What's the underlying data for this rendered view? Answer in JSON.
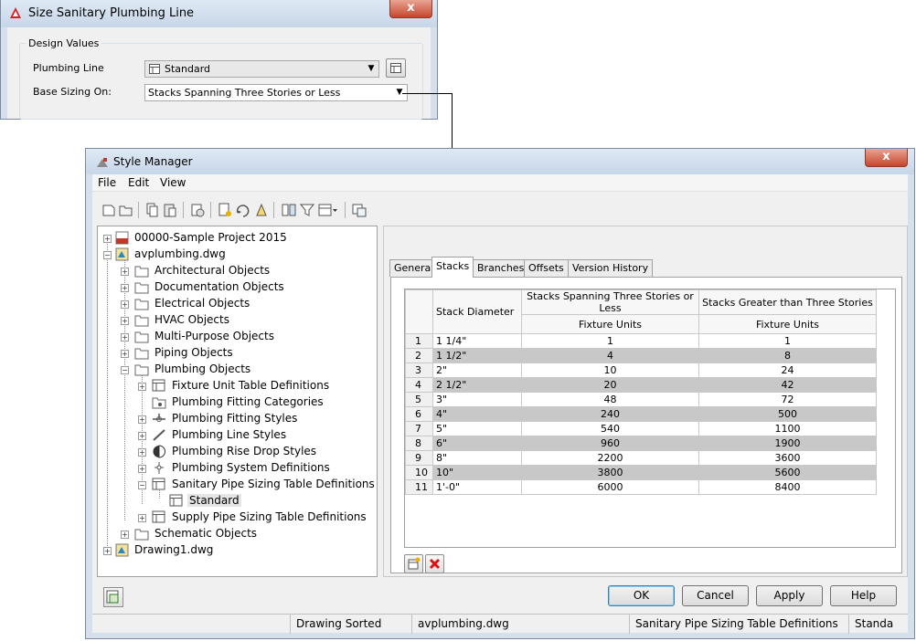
{
  "plumbing_dialog": {
    "title": "Size Sanitary Plumbing Line",
    "close": "x",
    "group_label": "Design Values",
    "plumbing_line_label": "Plumbing Line",
    "plumbing_line_value": "Standard",
    "base_sizing_label": "Base Sizing On:",
    "base_sizing_value": "Stacks Spanning Three Stories or Less"
  },
  "style_manager": {
    "title": "Style Manager",
    "close": "x",
    "menu": [
      "File",
      "Edit",
      "View"
    ],
    "tree": [
      {
        "label": "00000-Sample Project 2015",
        "icon": "project-icon"
      },
      {
        "label": "avplumbing.dwg",
        "icon": "drawing-icon"
      },
      {
        "label": "Architectural Objects",
        "icon": "folder-icon"
      },
      {
        "label": "Documentation Objects",
        "icon": "folder-icon"
      },
      {
        "label": "Electrical Objects",
        "icon": "folder-icon"
      },
      {
        "label": "HVAC Objects",
        "icon": "folder-icon"
      },
      {
        "label": "Multi-Purpose Objects",
        "icon": "folder-icon"
      },
      {
        "label": "Piping Objects",
        "icon": "folder-icon"
      },
      {
        "label": "Plumbing Objects",
        "icon": "folder-open-icon"
      },
      {
        "label": "Fixture Unit Table Definitions",
        "icon": "table-icon"
      },
      {
        "label": "Plumbing Fitting Categories",
        "icon": "category-icon"
      },
      {
        "label": "Plumbing Fitting Styles",
        "icon": "fitting-icon"
      },
      {
        "label": "Plumbing Line Styles",
        "icon": "line-icon"
      },
      {
        "label": "Plumbing Rise Drop Styles",
        "icon": "rise-drop-icon"
      },
      {
        "label": "Plumbing System Definitions",
        "icon": "system-icon"
      },
      {
        "label": "Sanitary Pipe Sizing Table Definitions",
        "icon": "table-icon"
      },
      {
        "label": "Standard",
        "icon": "table-icon"
      },
      {
        "label": "Supply Pipe Sizing Table Definitions",
        "icon": "table-icon"
      },
      {
        "label": "Schematic Objects",
        "icon": "folder-icon"
      },
      {
        "label": "Drawing1.dwg",
        "icon": "drawing-icon"
      }
    ],
    "tabs": [
      "General",
      "Stacks",
      "Branches",
      "Offsets",
      "Version History"
    ],
    "active_tab": "Stacks",
    "table": {
      "col_diameter": "Stack Diameter",
      "col_a": "Stacks Spanning Three Stories or Less",
      "col_b": "Stacks Greater than Three Stories",
      "sub_a": "Fixture Units",
      "sub_b": "Fixture Units",
      "rows": [
        {
          "n": "1",
          "d": "1 1/4\"",
          "a": "1",
          "b": "1"
        },
        {
          "n": "2",
          "d": "1 1/2\"",
          "a": "4",
          "b": "8"
        },
        {
          "n": "3",
          "d": "2\"",
          "a": "10",
          "b": "24"
        },
        {
          "n": "4",
          "d": "2 1/2\"",
          "a": "20",
          "b": "42"
        },
        {
          "n": "5",
          "d": "3\"",
          "a": "48",
          "b": "72"
        },
        {
          "n": "6",
          "d": "4\"",
          "a": "240",
          "b": "500"
        },
        {
          "n": "7",
          "d": "5\"",
          "a": "540",
          "b": "1100"
        },
        {
          "n": "8",
          "d": "6\"",
          "a": "960",
          "b": "1900"
        },
        {
          "n": "9",
          "d": "8\"",
          "a": "2200",
          "b": "3600"
        },
        {
          "n": "10",
          "d": "10\"",
          "a": "3800",
          "b": "5600"
        },
        {
          "n": "11",
          "d": "1'-0\"",
          "a": "6000",
          "b": "8400"
        }
      ]
    },
    "buttons": {
      "ok": "OK",
      "cancel": "Cancel",
      "apply": "Apply",
      "help": "Help"
    },
    "status": {
      "sort": "Drawing Sorted",
      "file": "avplumbing.dwg",
      "category": "Sanitary Pipe Sizing Table Definitions",
      "style": "Standa"
    }
  }
}
